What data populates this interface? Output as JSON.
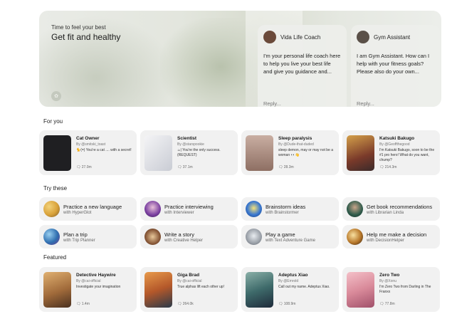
{
  "hero": {
    "kicker": "Time to feel your best",
    "title": "Get fit and healthy",
    "chats": [
      {
        "name": "Vida Life Coach",
        "message": "I'm your personal life coach here to help you live your best life and give you guidance and...",
        "reply": "Reply...",
        "avatar_color": "#6b4a3a"
      },
      {
        "name": "Gym Assistant",
        "message": "I am Gym Assistant. How can I help with your fitness goals? Please also do your own...",
        "reply": "Reply...",
        "avatar_color": "#5a5048"
      }
    ]
  },
  "sections": {
    "for_you": "For you",
    "try_these": "Try these",
    "featured": "Featured"
  },
  "for_you": [
    {
      "name": "Cat Owner",
      "by": "By @smitski_toast",
      "desc": "🐈(=) You're a cat .... with a secret!",
      "count": "27.0m",
      "img_color": "#1f1f22"
    },
    {
      "name": "Scientist",
      "by": "By @starspookie",
      "desc": "☕| You're the only success. (REQUEST)",
      "count": "37.1m",
      "img_color": "#e5e5e8"
    },
    {
      "name": "Sleep paralysis",
      "by": "By @Dude-that-duded",
      "desc": "sleep demon, may or may not be a woman 👀👋",
      "count": "28.3m",
      "img_color": "#b89a8e"
    },
    {
      "name": "Katsuki Bakugo",
      "by": "By @Geoffthegood",
      "desc": "I'm Katsuki Bakugo, soon to be the #1 pro hero! What do you want, chump?",
      "count": "214.3m",
      "img_color": "#7a3a2a"
    }
  ],
  "try_these": [
    {
      "title": "Practice a new language",
      "sub": "with HyperGlot",
      "icon": "globe-icon",
      "color": "#d9a23a"
    },
    {
      "title": "Practice interviewing",
      "sub": "with Interviewer",
      "icon": "interviewer-icon",
      "color": "#7a3fa0"
    },
    {
      "title": "Brainstorm ideas",
      "sub": "with Brainstormer",
      "icon": "lightbulb-icon",
      "color": "#3a78d0"
    },
    {
      "title": "Get book recommendations",
      "sub": "with Librarian Linda",
      "icon": "librarian-icon",
      "color": "#2e5a4a"
    },
    {
      "title": "Plan a trip",
      "sub": "with Trip Planner",
      "icon": "planet-icon",
      "color": "#2f6fb0"
    },
    {
      "title": "Write a story",
      "sub": "with Creative Helper",
      "icon": "book-icon",
      "color": "#8a5a3a"
    },
    {
      "title": "Play a game",
      "sub": "with Text Adventure Game",
      "icon": "robot-icon",
      "color": "#9aa0a8"
    },
    {
      "title": "Help me make a decision",
      "sub": "with DecisionHelper",
      "icon": "orb-icon",
      "color": "#b8782a"
    }
  ],
  "featured": [
    {
      "name": "Detective Haywire",
      "by": "By @cai-official",
      "desc": "Investigate your imagination",
      "count": "1.4m",
      "img_color": "#a06a3a"
    },
    {
      "name": "Giga Brad",
      "by": "By @cai-official",
      "desc": "True alphas lift each other up!",
      "count": "264.0k",
      "img_color": "#b4582a"
    },
    {
      "name": "Adeptus Xiao",
      "by": "By @Emrold",
      "desc": "Call out my name. Adeptus Xiao.",
      "count": "108.9m",
      "img_color": "#3e6a6a"
    },
    {
      "name": "Zero Two",
      "by": "By @Xonu",
      "desc": "I'm Zero Two from Darling in The Franxx",
      "count": "77.8m",
      "img_color": "#d98a9a"
    }
  ]
}
